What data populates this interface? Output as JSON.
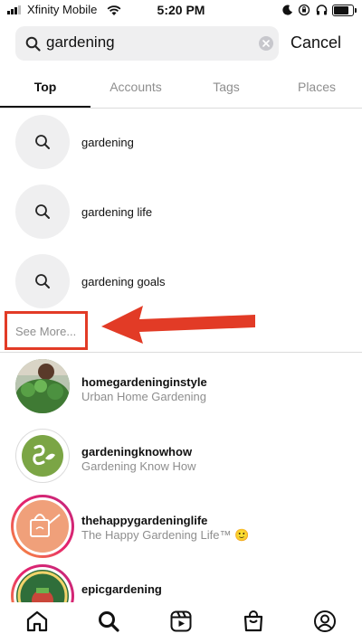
{
  "status_bar": {
    "carrier": "Xfinity Mobile",
    "time": "5:20 PM"
  },
  "search": {
    "query": "gardening",
    "cancel_label": "Cancel"
  },
  "tabs": [
    {
      "label": "Top",
      "active": true
    },
    {
      "label": "Accounts",
      "active": false
    },
    {
      "label": "Tags",
      "active": false
    },
    {
      "label": "Places",
      "active": false
    }
  ],
  "suggestions": [
    {
      "text": "gardening",
      "icon": "search-icon"
    },
    {
      "text": "gardening life",
      "icon": "search-icon"
    },
    {
      "text": "gardening goals",
      "icon": "search-icon"
    }
  ],
  "see_more_label": "See More...",
  "accounts": [
    {
      "username": "homegardeninginstyle",
      "name": "Urban Home Gardening"
    },
    {
      "username": "gardeningknowhow",
      "name": "Gardening Know How"
    },
    {
      "username": "thehappygardeninglife",
      "name": "The Happy Gardening Life™ 🙂"
    },
    {
      "username": "epicgardening",
      "name": ""
    }
  ],
  "bottom_nav": {
    "items": [
      "home-icon",
      "search-icon",
      "reels-icon",
      "shop-icon",
      "profile-icon"
    ]
  },
  "colors": {
    "annotation_red": "#e23b26",
    "secondary_text": "#8e8e8e"
  }
}
